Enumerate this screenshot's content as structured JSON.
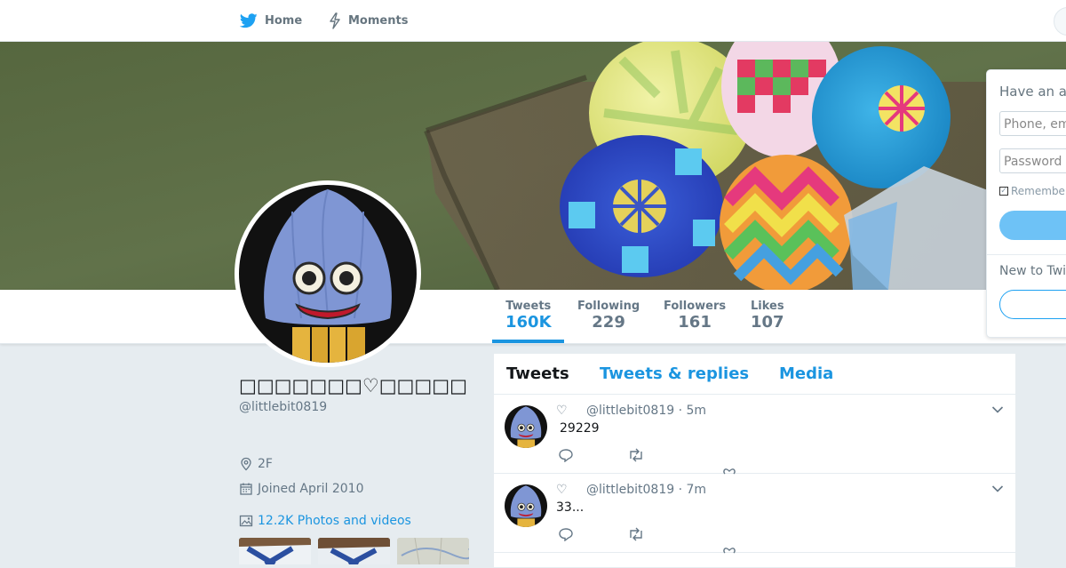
{
  "topnav": {
    "home_label": "Home",
    "moments_label": "Moments"
  },
  "colors": {
    "accent": "#1b95e0",
    "twitter_blue": "#1da1f2",
    "background": "#e6ecf0",
    "muted": "#657786"
  },
  "stats": [
    {
      "label": "Tweets",
      "value": "160K",
      "active": true
    },
    {
      "label": "Following",
      "value": "229"
    },
    {
      "label": "Followers",
      "value": "161"
    },
    {
      "label": "Likes",
      "value": "107"
    }
  ],
  "profile": {
    "display_name": "□□□□□□□♡□□□□□",
    "handle": "@littlebit0819",
    "location": "2F",
    "joined": "Joined April 2010",
    "photos_link": "12.2K Photos and videos"
  },
  "login": {
    "title": "Have an ac",
    "username_placeholder": "Phone, em",
    "password_placeholder": "Password",
    "remember_label": "Remember",
    "new_to": "New to Twi"
  },
  "timeline": {
    "tabs": [
      "Tweets",
      "Tweets & replies",
      "Media"
    ],
    "tweets": [
      {
        "name_glyph": "♡",
        "handle_time": "@littlebit0819 · 5m",
        "text": "29229"
      },
      {
        "name_glyph": "♡",
        "handle_time": "@littlebit0819 · 7m",
        "text": "33..."
      }
    ]
  },
  "icons": [
    "twitter-bird-icon",
    "lightning-icon",
    "location-pin-icon",
    "calendar-icon",
    "image-icon",
    "reply-icon",
    "retweet-icon",
    "like-icon",
    "chevron-down-icon"
  ]
}
